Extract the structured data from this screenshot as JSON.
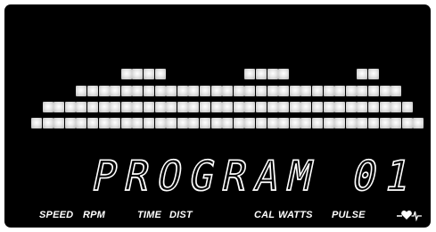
{
  "display": {
    "message": "PROGRAM 01",
    "profile_levels": [
      1,
      2,
      2,
      2,
      3,
      3,
      3,
      3,
      4,
      4,
      4,
      4,
      3,
      3,
      3,
      3,
      3,
      3,
      3,
      4,
      4,
      4,
      4,
      3,
      3,
      3,
      3,
      3,
      3,
      4,
      4,
      3,
      3,
      2,
      1
    ]
  },
  "indicators": {
    "speed": "SPEED",
    "rpm": "RPM",
    "time": "TIME",
    "dist": "DIST",
    "cal": "CAL",
    "watts": "WATTS",
    "pulse": "PULSE"
  },
  "colors": {
    "background": "#000000",
    "segment": "#ffffff"
  }
}
